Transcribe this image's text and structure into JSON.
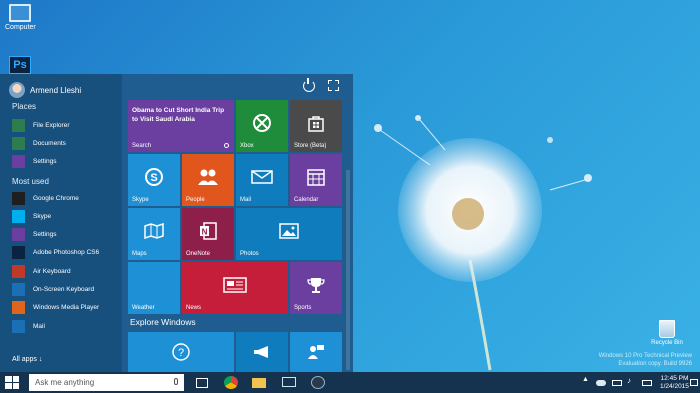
{
  "desktop": {
    "computer_label": "Computer",
    "ps_glyph": "Ps",
    "recycle_label": "Recycle Bin",
    "watermark": [
      "Windows 10 Pro Technical Preview",
      "Evaluation copy. Build 9926"
    ]
  },
  "start": {
    "user_name": "Armend Lleshi",
    "places_header": "Places",
    "places": [
      {
        "label": "File Explorer",
        "icon": "folder-icon",
        "color": "#2e7d4f"
      },
      {
        "label": "Documents",
        "icon": "documents-icon",
        "color": "#2e7d4f"
      },
      {
        "label": "Settings",
        "icon": "settings-icon",
        "color": "#6b3fa0"
      }
    ],
    "most_used_header": "Most used",
    "most_used": [
      {
        "label": "Google Chrome",
        "icon": "chrome-icon",
        "color": "#1f1f1f"
      },
      {
        "label": "Skype",
        "icon": "skype-icon",
        "color": "#00aff0"
      },
      {
        "label": "Settings",
        "icon": "settings-icon",
        "color": "#6b3fa0"
      },
      {
        "label": "Adobe Photoshop CS6",
        "icon": "photoshop-icon",
        "color": "#0a2340"
      },
      {
        "label": "Air Keyboard",
        "icon": "air-keyboard-icon",
        "color": "#c0392b"
      },
      {
        "label": "On-Screen Keyboard",
        "icon": "keyboard-icon",
        "color": "#1a6fb5"
      },
      {
        "label": "Windows Media Player",
        "icon": "media-player-icon",
        "color": "#e0651c"
      },
      {
        "label": "Mail",
        "icon": "mail-icon",
        "color": "#1a6fb5"
      }
    ],
    "all_apps": "All apps ↓",
    "explore": "Explore Windows",
    "tiles": {
      "news_headline": "Obama to Cut Short India Trip to Visit Saudi Arabia",
      "search": "Search",
      "xbox": "Xbox",
      "store": "Store (Beta)",
      "skype": "Skype",
      "people": "People",
      "mail": "Mail",
      "calendar": "Calendar",
      "maps": "Maps",
      "onenote": "OneNote",
      "photos": "Photos",
      "weather": "Weather",
      "news": "News",
      "sports": "Sports"
    },
    "colors": {
      "purple": "#6b3fa0",
      "green": "#1e8c3a",
      "gray": "#4a4a4a",
      "blue": "#1e90d6",
      "orange": "#e0561c",
      "teal": "#0f7dbd",
      "maroon": "#8e1e4a",
      "crimson": "#c41e3a"
    }
  },
  "taskbar": {
    "search_placeholder": "Ask me anything",
    "time": "12:45 PM",
    "date": "1/24/2015"
  }
}
